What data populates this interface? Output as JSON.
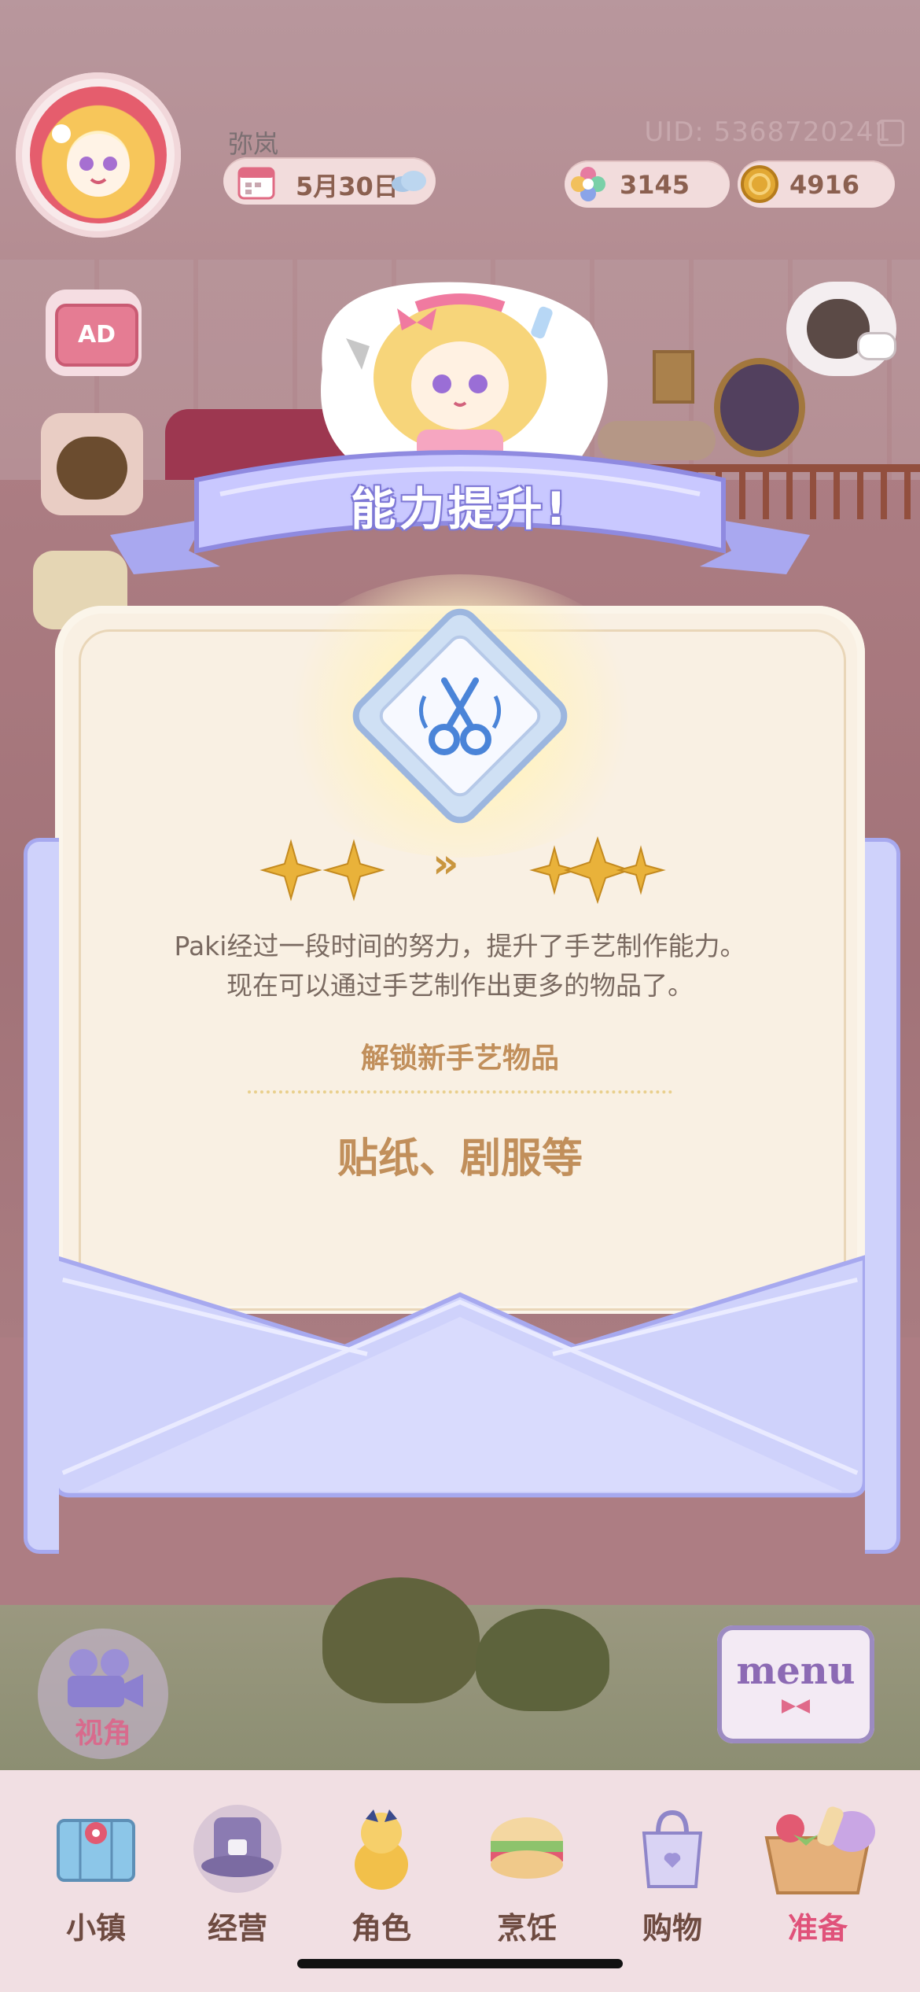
{
  "header": {
    "username": "弥岚",
    "uid": "UID: 5368720241",
    "date": "5月30日",
    "gems": "3145",
    "coins": "4916"
  },
  "side_icons": {
    "ad_label": "AD"
  },
  "popup": {
    "title": "能力提升!",
    "description_line1": "Paki经过一段时间的努力，提升了手艺制作能力。",
    "description_line2": "现在可以通过手艺制作出更多的物品了。",
    "unlock_title": "解锁新手艺物品",
    "unlock_items": "贴纸、剧服等",
    "level_from_stars": 2,
    "level_to_stars": 3,
    "arrow": "»"
  },
  "controls": {
    "view_label": "视角",
    "menu_label": "menu"
  },
  "nav": {
    "items": [
      {
        "label": "小镇",
        "icon": "map-icon"
      },
      {
        "label": "经营",
        "icon": "hat-lock-icon"
      },
      {
        "label": "角色",
        "icon": "character-icon"
      },
      {
        "label": "烹饪",
        "icon": "cake-icon"
      },
      {
        "label": "购物",
        "icon": "shopping-bag-icon"
      },
      {
        "label": "准备",
        "icon": "basket-icon"
      }
    ]
  },
  "colors": {
    "accent_purple": "#8f8ae0",
    "title_gold": "#c18f5b",
    "card_bg": "#f9f0e3",
    "envelope": "#cfd2fb"
  }
}
